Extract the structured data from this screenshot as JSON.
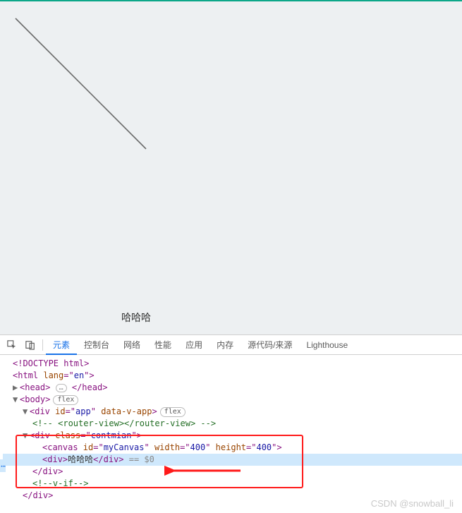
{
  "page": {
    "text": "哈哈哈"
  },
  "tabs": {
    "elements": "元素",
    "console": "控制台",
    "network": "网络",
    "performance": "性能",
    "application": "应用",
    "memory": "内存",
    "sources": "源代码/来源",
    "lighthouse": "Lighthouse"
  },
  "tree": {
    "doctype_open": "<!",
    "doctype_text": "DOCTYPE html",
    "doctype_close": ">",
    "html_open": "<html ",
    "html_attr": "lang",
    "html_eq": "=\"",
    "html_val": "en",
    "html_end": "\">",
    "head_open": "<head>",
    "head_close": "</head>",
    "body_open": "<body>",
    "ell": "…",
    "flex_badge": "flex",
    "app_open_1": "<div ",
    "app_id_attr": "id",
    "app_id_val": "app",
    "app_sp": " ",
    "app_data_attr": "data-v-app",
    "app_open_2": ">",
    "comment_open": "<!-- ",
    "comment_text": "<router-view></router-view>",
    "comment_close": " -->",
    "contmian_open_1": "<div ",
    "contmian_cls_attr": "class",
    "contmian_cls_val": "contmian",
    "contmian_open_2": ">",
    "canvas_open_1": "<canvas ",
    "canvas_id_attr": "id",
    "canvas_id_val": "myCanvas",
    "canvas_w_attr": "width",
    "canvas_w_val": "400",
    "canvas_h_attr": "height",
    "canvas_h_val": "400",
    "canvas_open_2": ">",
    "div_open": "<div>",
    "div_text": "哈哈哈",
    "div_close": "</div>",
    "sel": " == $0",
    "close_div": "</div>",
    "truncated_open": "<!",
    "truncated_text": "--v-if--",
    "truncated_close": ">"
  },
  "watermark": "CSDN @snowball_li"
}
